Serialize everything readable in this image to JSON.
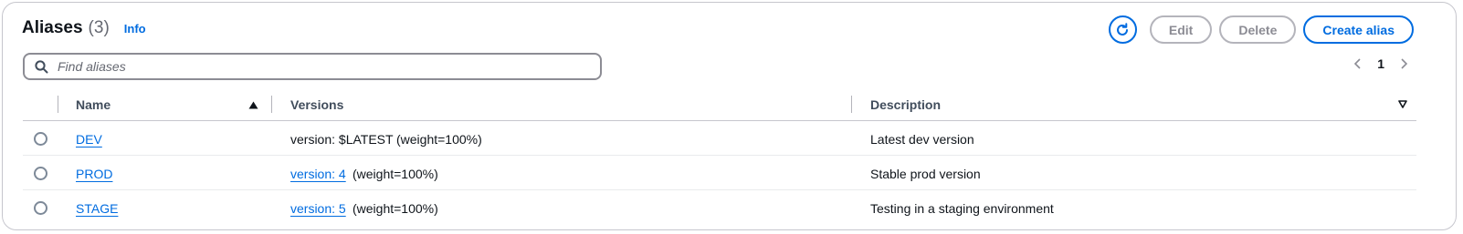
{
  "header": {
    "title": "Aliases",
    "count": "(3)",
    "info_label": "Info"
  },
  "actions": {
    "refresh_icon": "refresh-icon",
    "edit_label": "Edit",
    "delete_label": "Delete",
    "create_label": "Create alias"
  },
  "search": {
    "placeholder": "Find aliases",
    "value": ""
  },
  "pagination": {
    "current_page": "1"
  },
  "table": {
    "columns": {
      "name": "Name",
      "versions": "Versions",
      "description": "Description"
    },
    "sort": {
      "column": "Name",
      "direction": "ascending"
    },
    "rows": [
      {
        "name": "DEV",
        "version_link": "",
        "version_text": "version: $LATEST",
        "weight": "(weight=100%)",
        "description": "Latest dev version"
      },
      {
        "name": "PROD",
        "version_link": "version: 4",
        "version_text": "",
        "weight": "(weight=100%)",
        "description": "Stable prod version"
      },
      {
        "name": "STAGE",
        "version_link": "version: 5",
        "version_text": "",
        "weight": "(weight=100%)",
        "description": "Testing in a staging environment"
      }
    ]
  },
  "colors": {
    "accent": "#006ce0",
    "disabled": "#8c8c94",
    "text": "#0f141a"
  }
}
